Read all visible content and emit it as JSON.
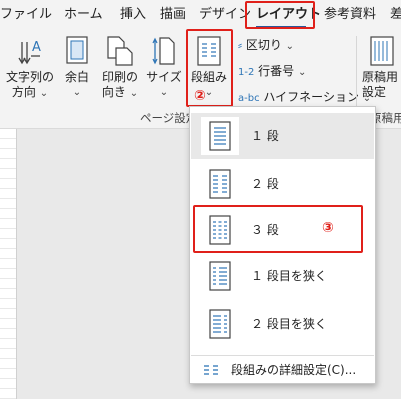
{
  "tabs": [
    {
      "label": "ファイル",
      "active": false
    },
    {
      "label": "ホーム",
      "active": false
    },
    {
      "label": "挿入",
      "active": false
    },
    {
      "label": "描画",
      "active": false
    },
    {
      "label": "デザイン",
      "active": false
    },
    {
      "label": "レイアウト",
      "active": true
    },
    {
      "label": "参考資料",
      "active": false
    },
    {
      "label": "差",
      "active": false
    }
  ],
  "ribbon": {
    "text_direction": {
      "line1": "文字列の",
      "line2": "方向"
    },
    "margins": {
      "line1": "余白"
    },
    "orientation": {
      "line1": "印刷の",
      "line2": "向き"
    },
    "size": {
      "line1": "サイズ"
    },
    "columns": {
      "line1": "段組み"
    },
    "breaks": "区切り",
    "line_numbers": "行番号",
    "hyphenation": "ハイフネーション",
    "manuscript": {
      "line1": "原稿用",
      "line2": "設定"
    },
    "group_page_setup": "ページ設定",
    "group_manuscript": "原稿用",
    "chevron": "⌄"
  },
  "annotations": {
    "step2": "②",
    "step3": "③"
  },
  "columns_menu": {
    "items": [
      {
        "label": "１ 段",
        "columns": 1,
        "hover": true
      },
      {
        "label": "２ 段",
        "columns": 2,
        "hover": false
      },
      {
        "label": "３ 段",
        "columns": 3,
        "hover": false
      },
      {
        "label": "１ 段目を狭く",
        "columns": "left",
        "hover": false
      },
      {
        "label": "２ 段目を狭く",
        "columns": "right",
        "hover": false
      }
    ],
    "more": "段組みの詳細設定(C)..."
  },
  "colors": {
    "accent": "#2b579a",
    "highlight_red": "#e0201a",
    "icon_blue": "#2e75b6"
  }
}
